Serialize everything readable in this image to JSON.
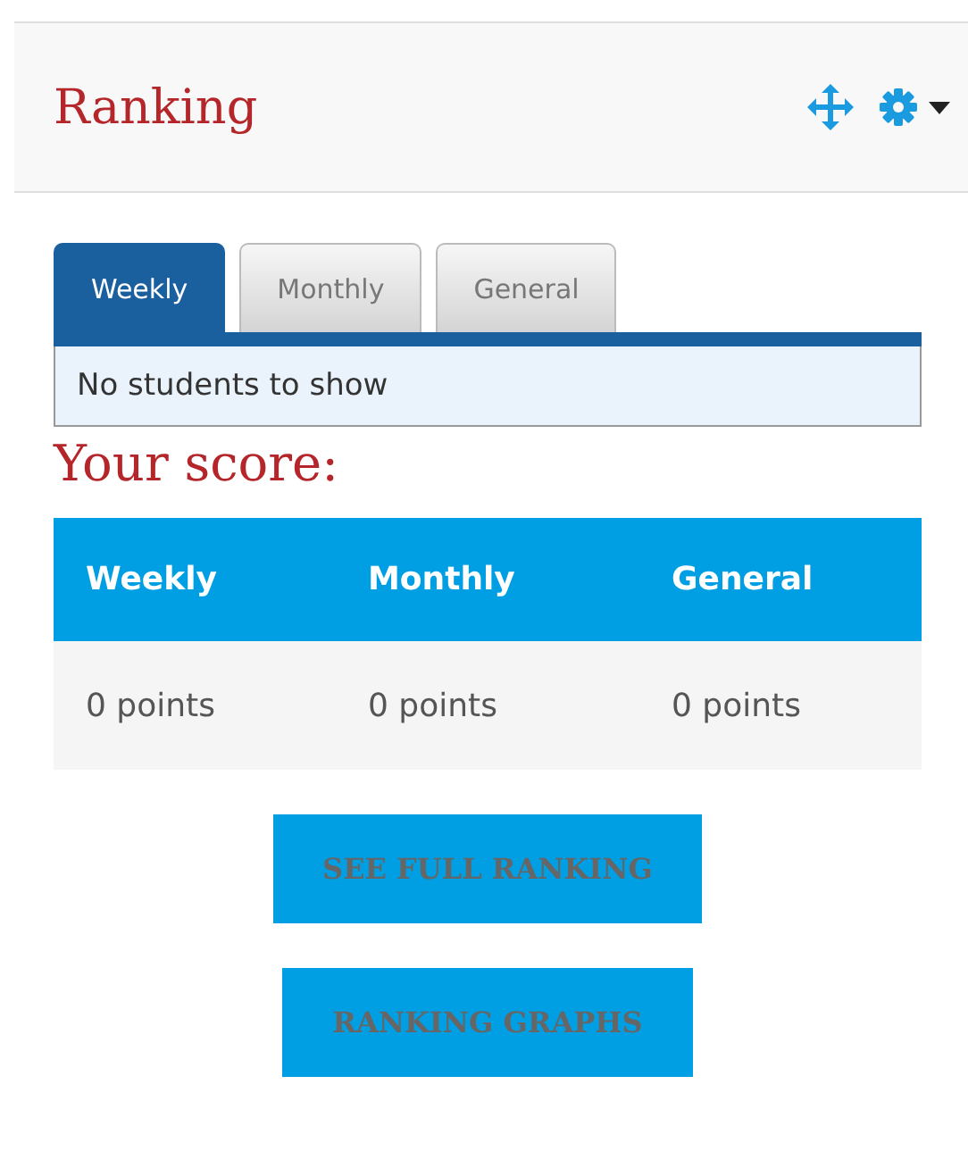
{
  "block": {
    "title": "Ranking"
  },
  "tabs": [
    {
      "label": "Weekly",
      "selected": true
    },
    {
      "label": "Monthly",
      "selected": false
    },
    {
      "label": "General",
      "selected": false
    }
  ],
  "tab_panel": {
    "message": "No students to show"
  },
  "score": {
    "heading": "Your score:",
    "columns": [
      "Weekly",
      "Monthly",
      "General"
    ],
    "values": [
      "0 points",
      "0 points",
      "0 points"
    ]
  },
  "buttons": [
    "SEE FULL RANKING",
    "RANKING GRAPHS"
  ]
}
